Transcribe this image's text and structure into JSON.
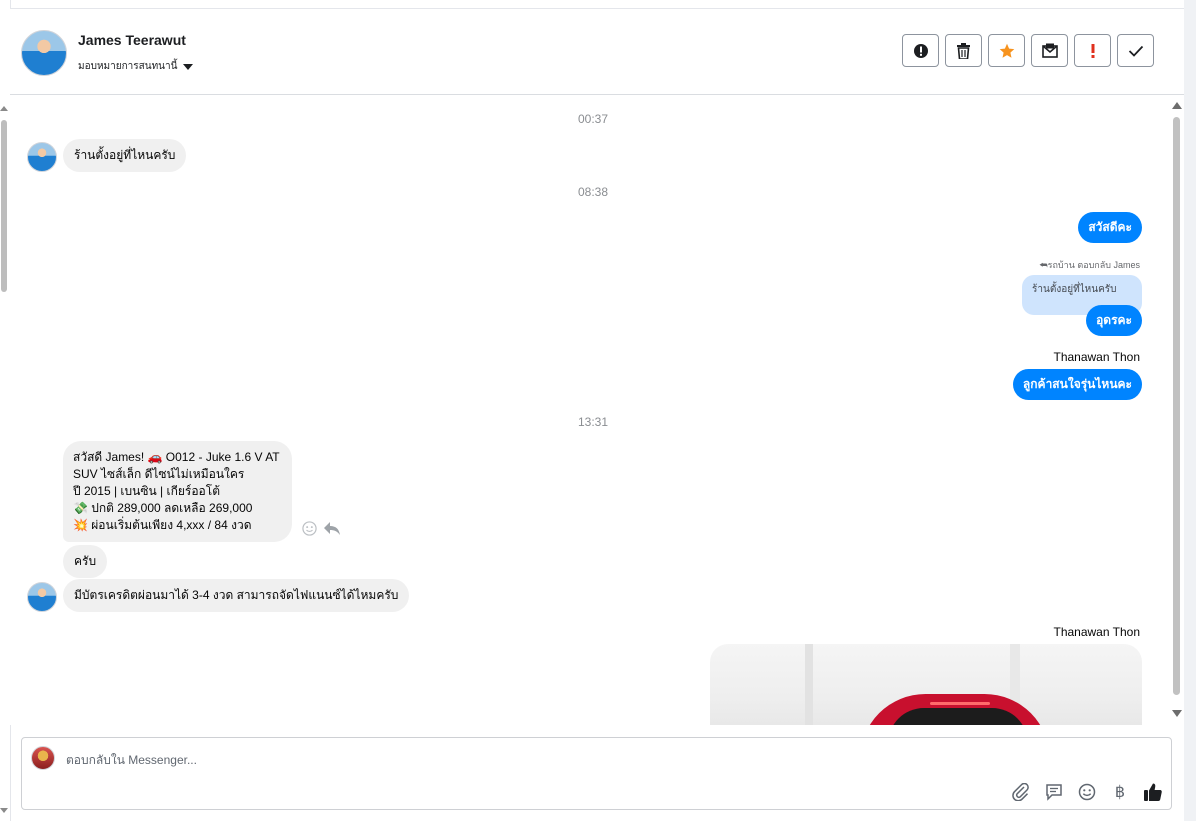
{
  "header": {
    "contact_name": "James Teerawut",
    "assign_label": "มอบหมายการสนทนานี้",
    "actions": [
      {
        "name": "mark-spam-button",
        "icon": "alert-circle-icon"
      },
      {
        "name": "delete-button",
        "icon": "trash-icon"
      },
      {
        "name": "star-button",
        "icon": "star-icon"
      },
      {
        "name": "mark-unread-button",
        "icon": "envelope-icon"
      },
      {
        "name": "mark-important-button",
        "icon": "exclamation-icon"
      },
      {
        "name": "mark-done-button",
        "icon": "check-icon"
      }
    ]
  },
  "thread": {
    "timestamps": [
      "00:37",
      "08:38",
      "13:31"
    ],
    "messages": {
      "m1": "ร้านตั้งอยู่ที่ไหนครับ",
      "m2": "สวัสดีคะ",
      "reply_note": "รถบ้าน ตอบกลับ James",
      "quoted": "ร้านตั้งอยู่ที่ไหนครับ",
      "m3": "อุดรคะ",
      "sender_1": "Thanawan Thon",
      "m4": "ลูกค้าสนใจรุ่นไหนคะ",
      "m5_lines": [
        "สวัสดี James! 🚗 O012 - Juke 1.6 V AT",
        "SUV ไซส์เล็ก ดีไซน์ไม่เหมือนใคร",
        "ปี 2015 | เบนซิน | เกียร์ออโต้",
        "💸 ปกติ 289,000 ลดเหลือ 269,000",
        "💥 ผ่อนเริ่มต้นเพียง 4,xxx / 84 งวด"
      ],
      "m6": "ครับ",
      "m7": "มีบัตรเครดิตผ่อนมาได้ 3-4 งวด สามารถจัดไฟแนนซ์ได้ไหมครับ",
      "sender_2": "Thanawan Thon"
    }
  },
  "composer": {
    "placeholder": "ตอบกลับใน Messenger...",
    "value": "",
    "tools": [
      "paperclip-icon",
      "saved-reply-icon",
      "emoji-icon",
      "baht-icon",
      "thumbs-up-icon"
    ],
    "baht_symbol": "฿"
  },
  "colors": {
    "accent": "#0084ff",
    "incoming_bubble": "#f0f0f0",
    "quoted_bubble": "#cfe4fd"
  }
}
